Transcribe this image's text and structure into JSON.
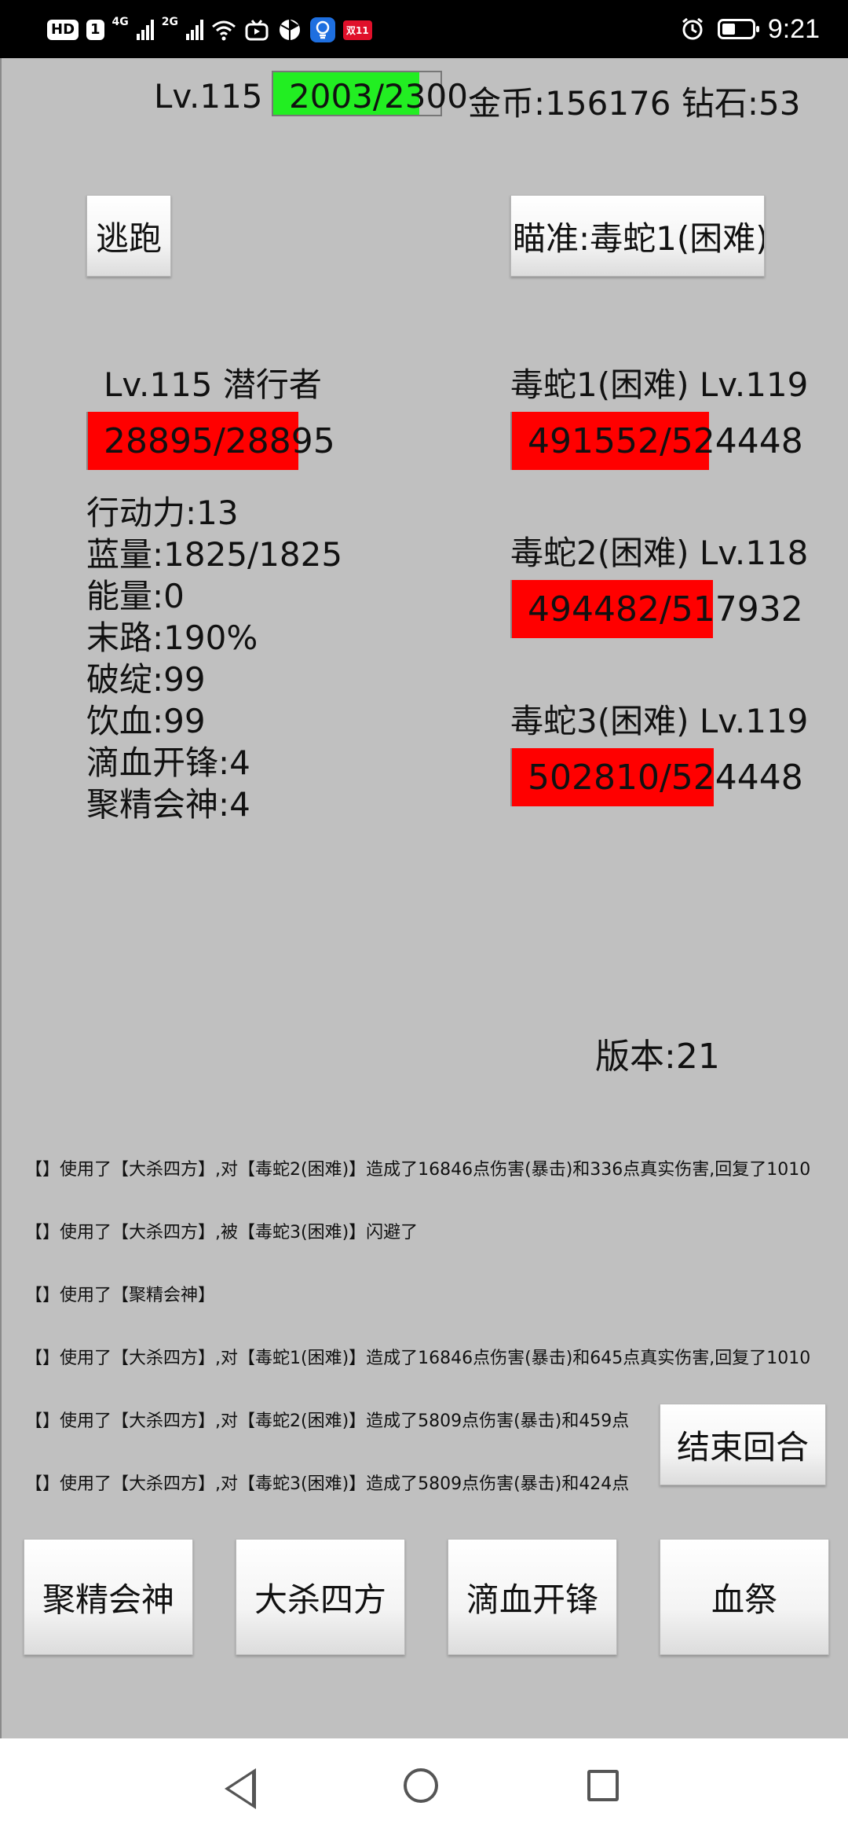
{
  "status_bar": {
    "chip_hd": "HD",
    "chip_sim": "1",
    "net1": "4G",
    "net2": "2G",
    "badge_red": "双11",
    "time": "9:21",
    "battery_level_pct": 45
  },
  "top": {
    "level": "Lv.115",
    "xp_text": "2003/2300",
    "xp_fraction": 0.871,
    "xp_color": "#22ee22",
    "currency": "金币:156176  钻石:53"
  },
  "buttons": {
    "flee": "逃跑",
    "target": "瞄准:毒蛇1(困难)",
    "end_turn": "结束回合"
  },
  "player": {
    "title": "Lv.115  潜行者",
    "hp_text": "28895/28895",
    "hp_fraction": 1.0,
    "stats": [
      "行动力:13",
      "蓝量:1825/1825",
      "能量:0",
      "末路:190%",
      "破绽:99",
      "饮血:99",
      "滴血开锋:4",
      "聚精会神:4"
    ]
  },
  "enemies": [
    {
      "name": "毒蛇1(困难)  Lv.119",
      "hp_text": "491552/524448",
      "hp_fraction": 0.937
    },
    {
      "name": "毒蛇2(困难)  Lv.118",
      "hp_text": "494482/517932",
      "hp_fraction": 0.955
    },
    {
      "name": "毒蛇3(困难)  Lv.119",
      "hp_text": "502810/524448",
      "hp_fraction": 0.959
    }
  ],
  "hp_color": "#ff0000",
  "version": "版本:21",
  "log": [
    "【】使用了【大杀四方】,对【毒蛇2(困难)】造成了16846点伤害(暴击)和336点真实伤害,回复了1010",
    "【】使用了【大杀四方】,被【毒蛇3(困难)】闪避了",
    "【】使用了【聚精会神】",
    "【】使用了【大杀四方】,对【毒蛇1(困难)】造成了16846点伤害(暴击)和645点真实伤害,回复了1010",
    "【】使用了【大杀四方】,对【毒蛇2(困难)】造成了5809点伤害(暴击)和459点",
    "【】使用了【大杀四方】,对【毒蛇3(困难)】造成了5809点伤害(暴击)和424点"
  ],
  "skills": [
    "聚精会神",
    "大杀四方",
    "滴血开锋",
    "血祭"
  ]
}
